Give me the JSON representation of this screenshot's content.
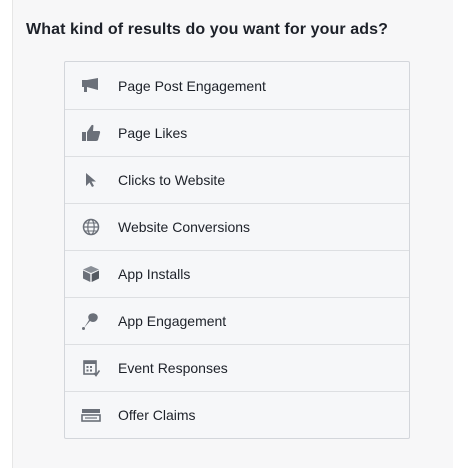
{
  "heading": "What kind of results do you want for your ads?",
  "objectives": [
    {
      "label": "Page Post Engagement",
      "icon": "megaphone-icon"
    },
    {
      "label": "Page Likes",
      "icon": "thumbs-up-icon"
    },
    {
      "label": "Clicks to Website",
      "icon": "cursor-icon"
    },
    {
      "label": "Website Conversions",
      "icon": "globe-icon"
    },
    {
      "label": "App Installs",
      "icon": "box-icon"
    },
    {
      "label": "App Engagement",
      "icon": "joystick-icon"
    },
    {
      "label": "Event Responses",
      "icon": "calendar-icon"
    },
    {
      "label": "Offer Claims",
      "icon": "offer-tag-icon"
    }
  ],
  "colors": {
    "text": "#1d2129",
    "icon": "#6b7079",
    "list_bg": "#f6f7f9",
    "border": "#dddfe2"
  }
}
